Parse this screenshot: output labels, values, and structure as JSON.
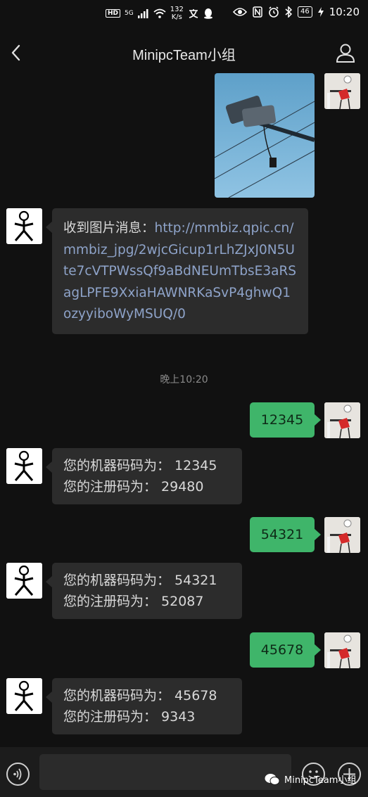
{
  "status_bar": {
    "network": "5G",
    "hd": "HD",
    "speed_value": "132",
    "speed_unit": "K/s",
    "battery": "46",
    "time": "10:20"
  },
  "header": {
    "title": "MinipcTeam小组"
  },
  "messages": {
    "image_notice_prefix": "收到图片消息：",
    "image_notice_link": "http://mmbiz.qpic.cn/mmbiz_jpg/2wjcGicup1rLhZJxJ0N5Ute7cVTPWssQf9aBdNEUmTbsE3aRSagLPFE9XxiaHAWNRKaSvP4ghwQ1ozyyiboWyMSUQ/0",
    "timestamp": "晚上10:20",
    "sent_1": "12345",
    "reply_1_line1": "您的机器码码为：  12345",
    "reply_1_line2": "您的注册码为：  29480",
    "sent_2": "54321",
    "reply_2_line1": "您的机器码码为：  54321",
    "reply_2_line2": "您的注册码为：  52087",
    "sent_3": "45678",
    "reply_3_line1": "您的机器码码为：  45678",
    "reply_3_line2": "您的注册码为：  9343"
  },
  "watermark": {
    "text": "MinipcTeam小组"
  },
  "icons": {
    "back": "chevron-left-icon",
    "profile": "person-icon",
    "voice": "voice-icon",
    "emoji": "emoji-icon",
    "plus": "plus-icon"
  },
  "colors": {
    "background": "#111111",
    "bubble_left": "#2c2c2c",
    "bubble_right": "#3fb56a",
    "link": "#8ea3c9"
  }
}
